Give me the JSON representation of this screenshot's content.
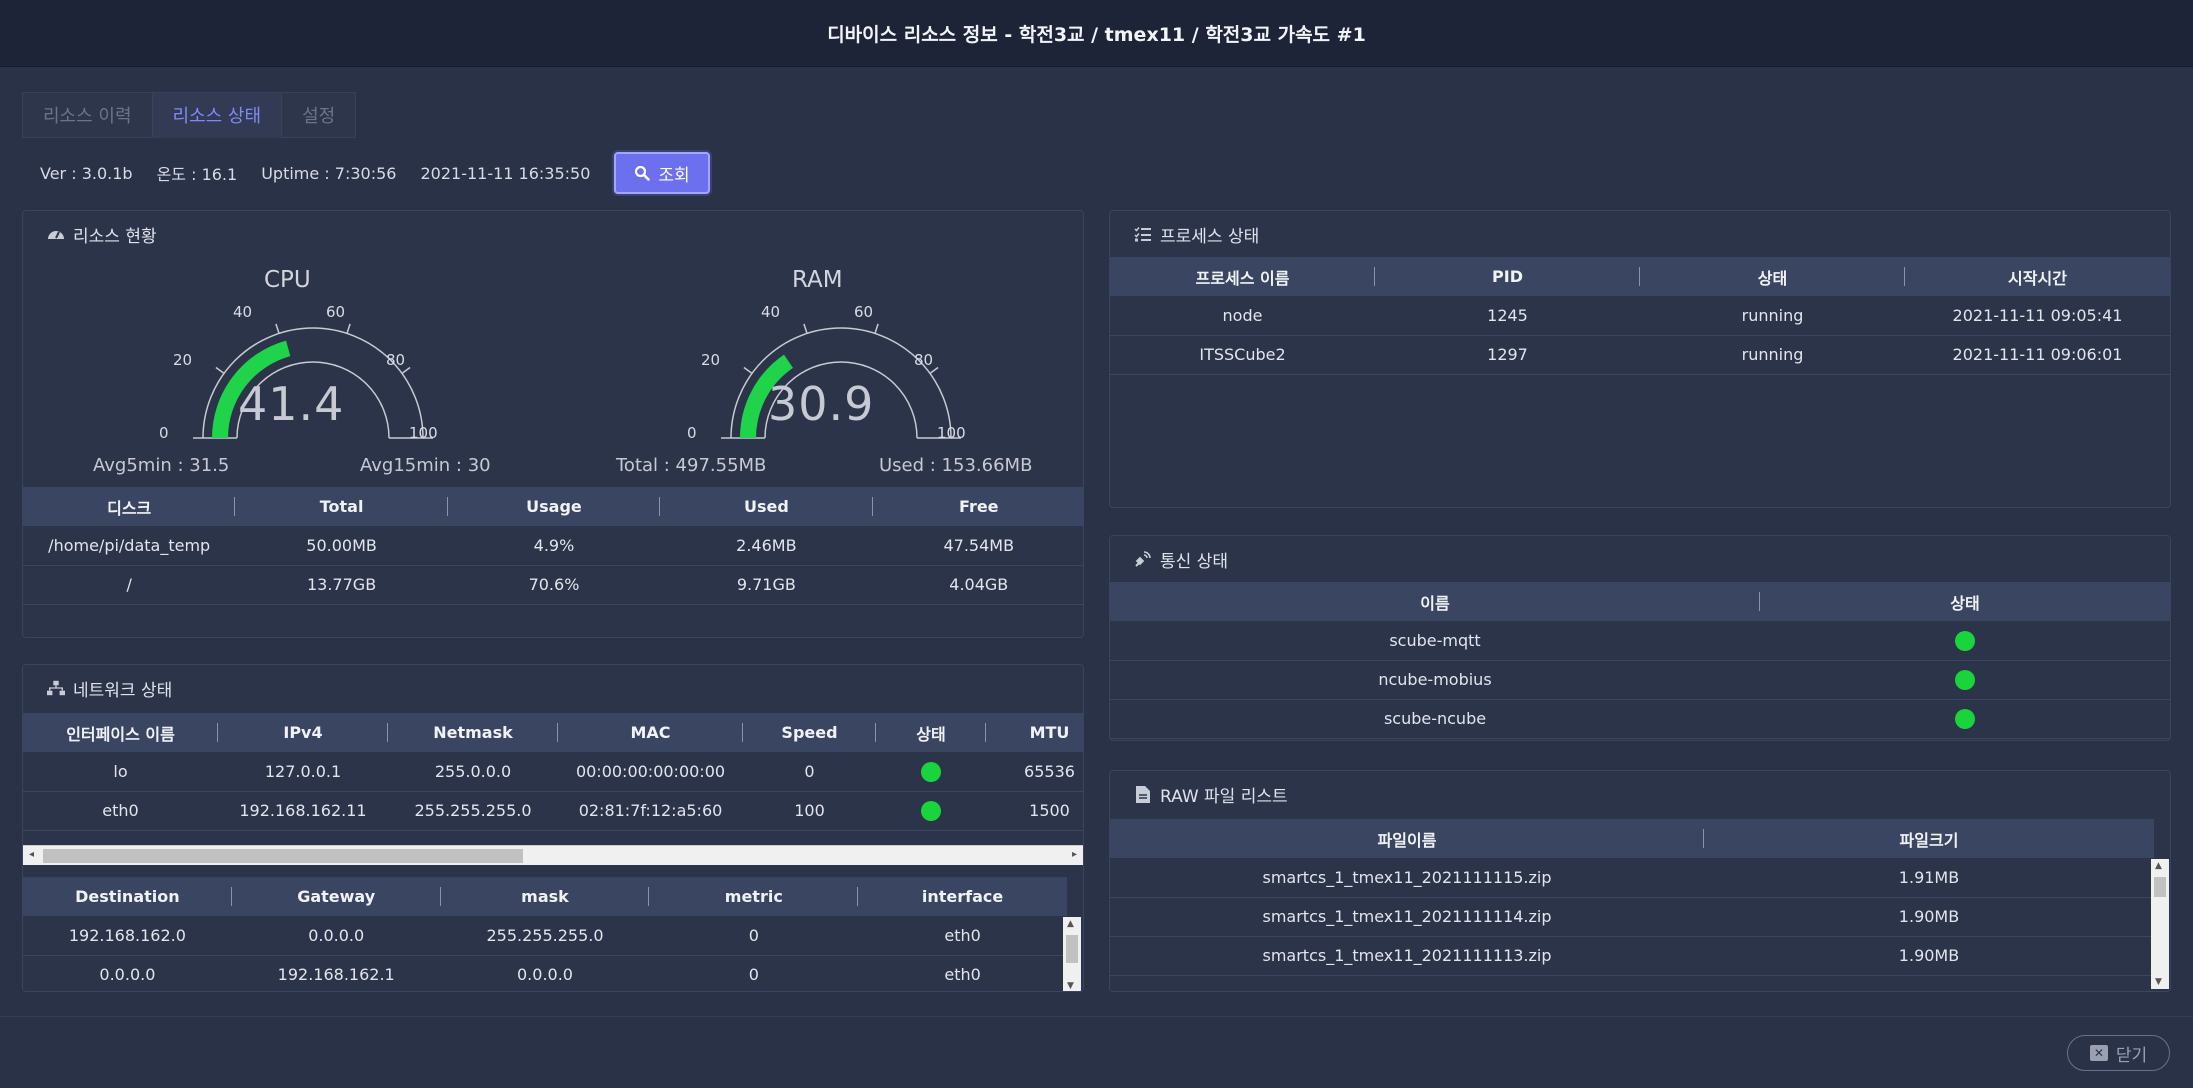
{
  "window": {
    "title": "디바이스 리소스 정보 - 학전3교 / tmex11 / 학전3교 가속도 #1"
  },
  "tabs": [
    {
      "label": "리소스 이력",
      "active": false
    },
    {
      "label": "리소스 상태",
      "active": true
    },
    {
      "label": "설정",
      "active": false
    }
  ],
  "info": {
    "version": "Ver : 3.0.1b",
    "temperature": "온도 : 16.1",
    "uptime": "Uptime : 7:30:56",
    "datetime": "2021-11-11 16:35:50",
    "search_label": "조회"
  },
  "resource": {
    "title": "리소스 현황",
    "cpu": {
      "label": "CPU",
      "value": 41.4,
      "value_text": "41.4",
      "ticks": [
        "0",
        "20",
        "40",
        "60",
        "80",
        "100"
      ],
      "avg5": "Avg5min : 31.5",
      "avg15": "Avg15min : 30"
    },
    "ram": {
      "label": "RAM",
      "value": 30.9,
      "value_text": "30.9",
      "ticks": [
        "0",
        "20",
        "40",
        "60",
        "80",
        "100"
      ],
      "total": "Total : 497.55MB",
      "used": "Used : 153.66MB"
    },
    "disk_headers": [
      "디스크",
      "Total",
      "Usage",
      "Used",
      "Free"
    ],
    "disk_rows": [
      [
        "/home/pi/data_temp",
        "50.00MB",
        "4.9%",
        "2.46MB",
        "47.54MB"
      ],
      [
        "/",
        "13.77GB",
        "70.6%",
        "9.71GB",
        "4.04GB"
      ]
    ]
  },
  "network": {
    "title": "네트워크 상태",
    "headers": [
      "인터페이스 이름",
      "IPv4",
      "Netmask",
      "MAC",
      "Speed",
      "상태",
      "MTU"
    ],
    "rows": [
      [
        "lo",
        "127.0.0.1",
        "255.0.0.0",
        "00:00:00:00:00:00",
        "0",
        "on",
        "65536"
      ],
      [
        "eth0",
        "192.168.162.11",
        "255.255.255.0",
        "02:81:7f:12:a5:60",
        "100",
        "on",
        "1500"
      ]
    ],
    "route_headers": [
      "Destination",
      "Gateway",
      "mask",
      "metric",
      "interface"
    ],
    "route_rows": [
      [
        "192.168.162.0",
        "0.0.0.0",
        "255.255.255.0",
        "0",
        "eth0"
      ],
      [
        "0.0.0.0",
        "192.168.162.1",
        "0.0.0.0",
        "0",
        "eth0"
      ]
    ]
  },
  "process": {
    "title": "프로세스 상태",
    "headers": [
      "프로세스 이름",
      "PID",
      "상태",
      "시작시간"
    ],
    "rows": [
      [
        "node",
        "1245",
        "running",
        "2021-11-11 09:05:41"
      ],
      [
        "ITSSCube2",
        "1297",
        "running",
        "2021-11-11 09:06:01"
      ]
    ]
  },
  "comm": {
    "title": "통신 상태",
    "headers": [
      "이름",
      "상태"
    ],
    "rows": [
      [
        "scube-mqtt"
      ],
      [
        "ncube-mobius"
      ],
      [
        "scube-ncube"
      ]
    ],
    "status_color": "#19d43a"
  },
  "raw": {
    "title": "RAW 파일 리스트",
    "headers": [
      "파일이름",
      "파일크기"
    ],
    "rows": [
      [
        "smartcs_1_tmex11_2021111115.zip",
        "1.91MB"
      ],
      [
        "smartcs_1_tmex11_2021111114.zip",
        "1.90MB"
      ],
      [
        "smartcs_1_tmex11_2021111113.zip",
        "1.90MB"
      ]
    ]
  },
  "footer": {
    "close_label": "닫기"
  }
}
